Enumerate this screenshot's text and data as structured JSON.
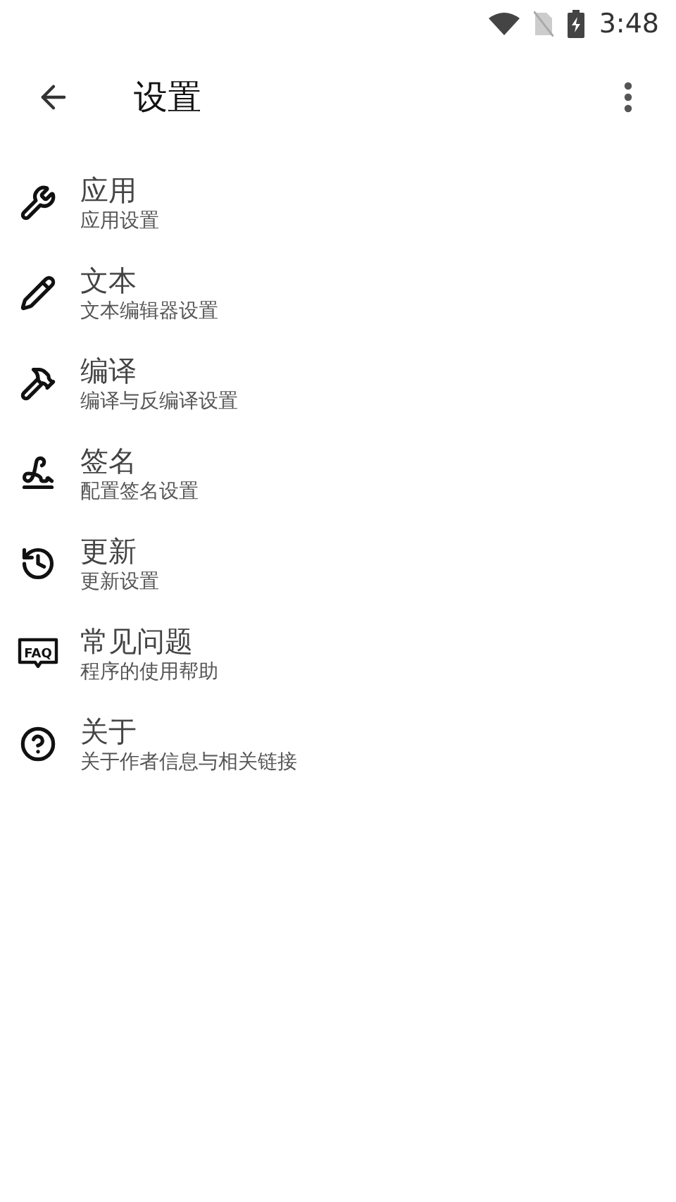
{
  "status_bar": {
    "time": "3:48"
  },
  "toolbar": {
    "title": "设置"
  },
  "items": [
    {
      "kind": "wrench",
      "title": "应用",
      "subtitle": "应用设置"
    },
    {
      "kind": "pencil",
      "title": "文本",
      "subtitle": "文本编辑器设置"
    },
    {
      "kind": "hammer",
      "title": "编译",
      "subtitle": "编译与反编译设置"
    },
    {
      "kind": "signature",
      "title": "签名",
      "subtitle": "配置签名设置"
    },
    {
      "kind": "update",
      "title": "更新",
      "subtitle": "更新设置"
    },
    {
      "kind": "faq",
      "icon_label": "FAQ",
      "title": "常见问题",
      "subtitle": "程序的使用帮助"
    },
    {
      "kind": "help",
      "title": "关于",
      "subtitle": "关于作者信息与相关链接"
    }
  ]
}
